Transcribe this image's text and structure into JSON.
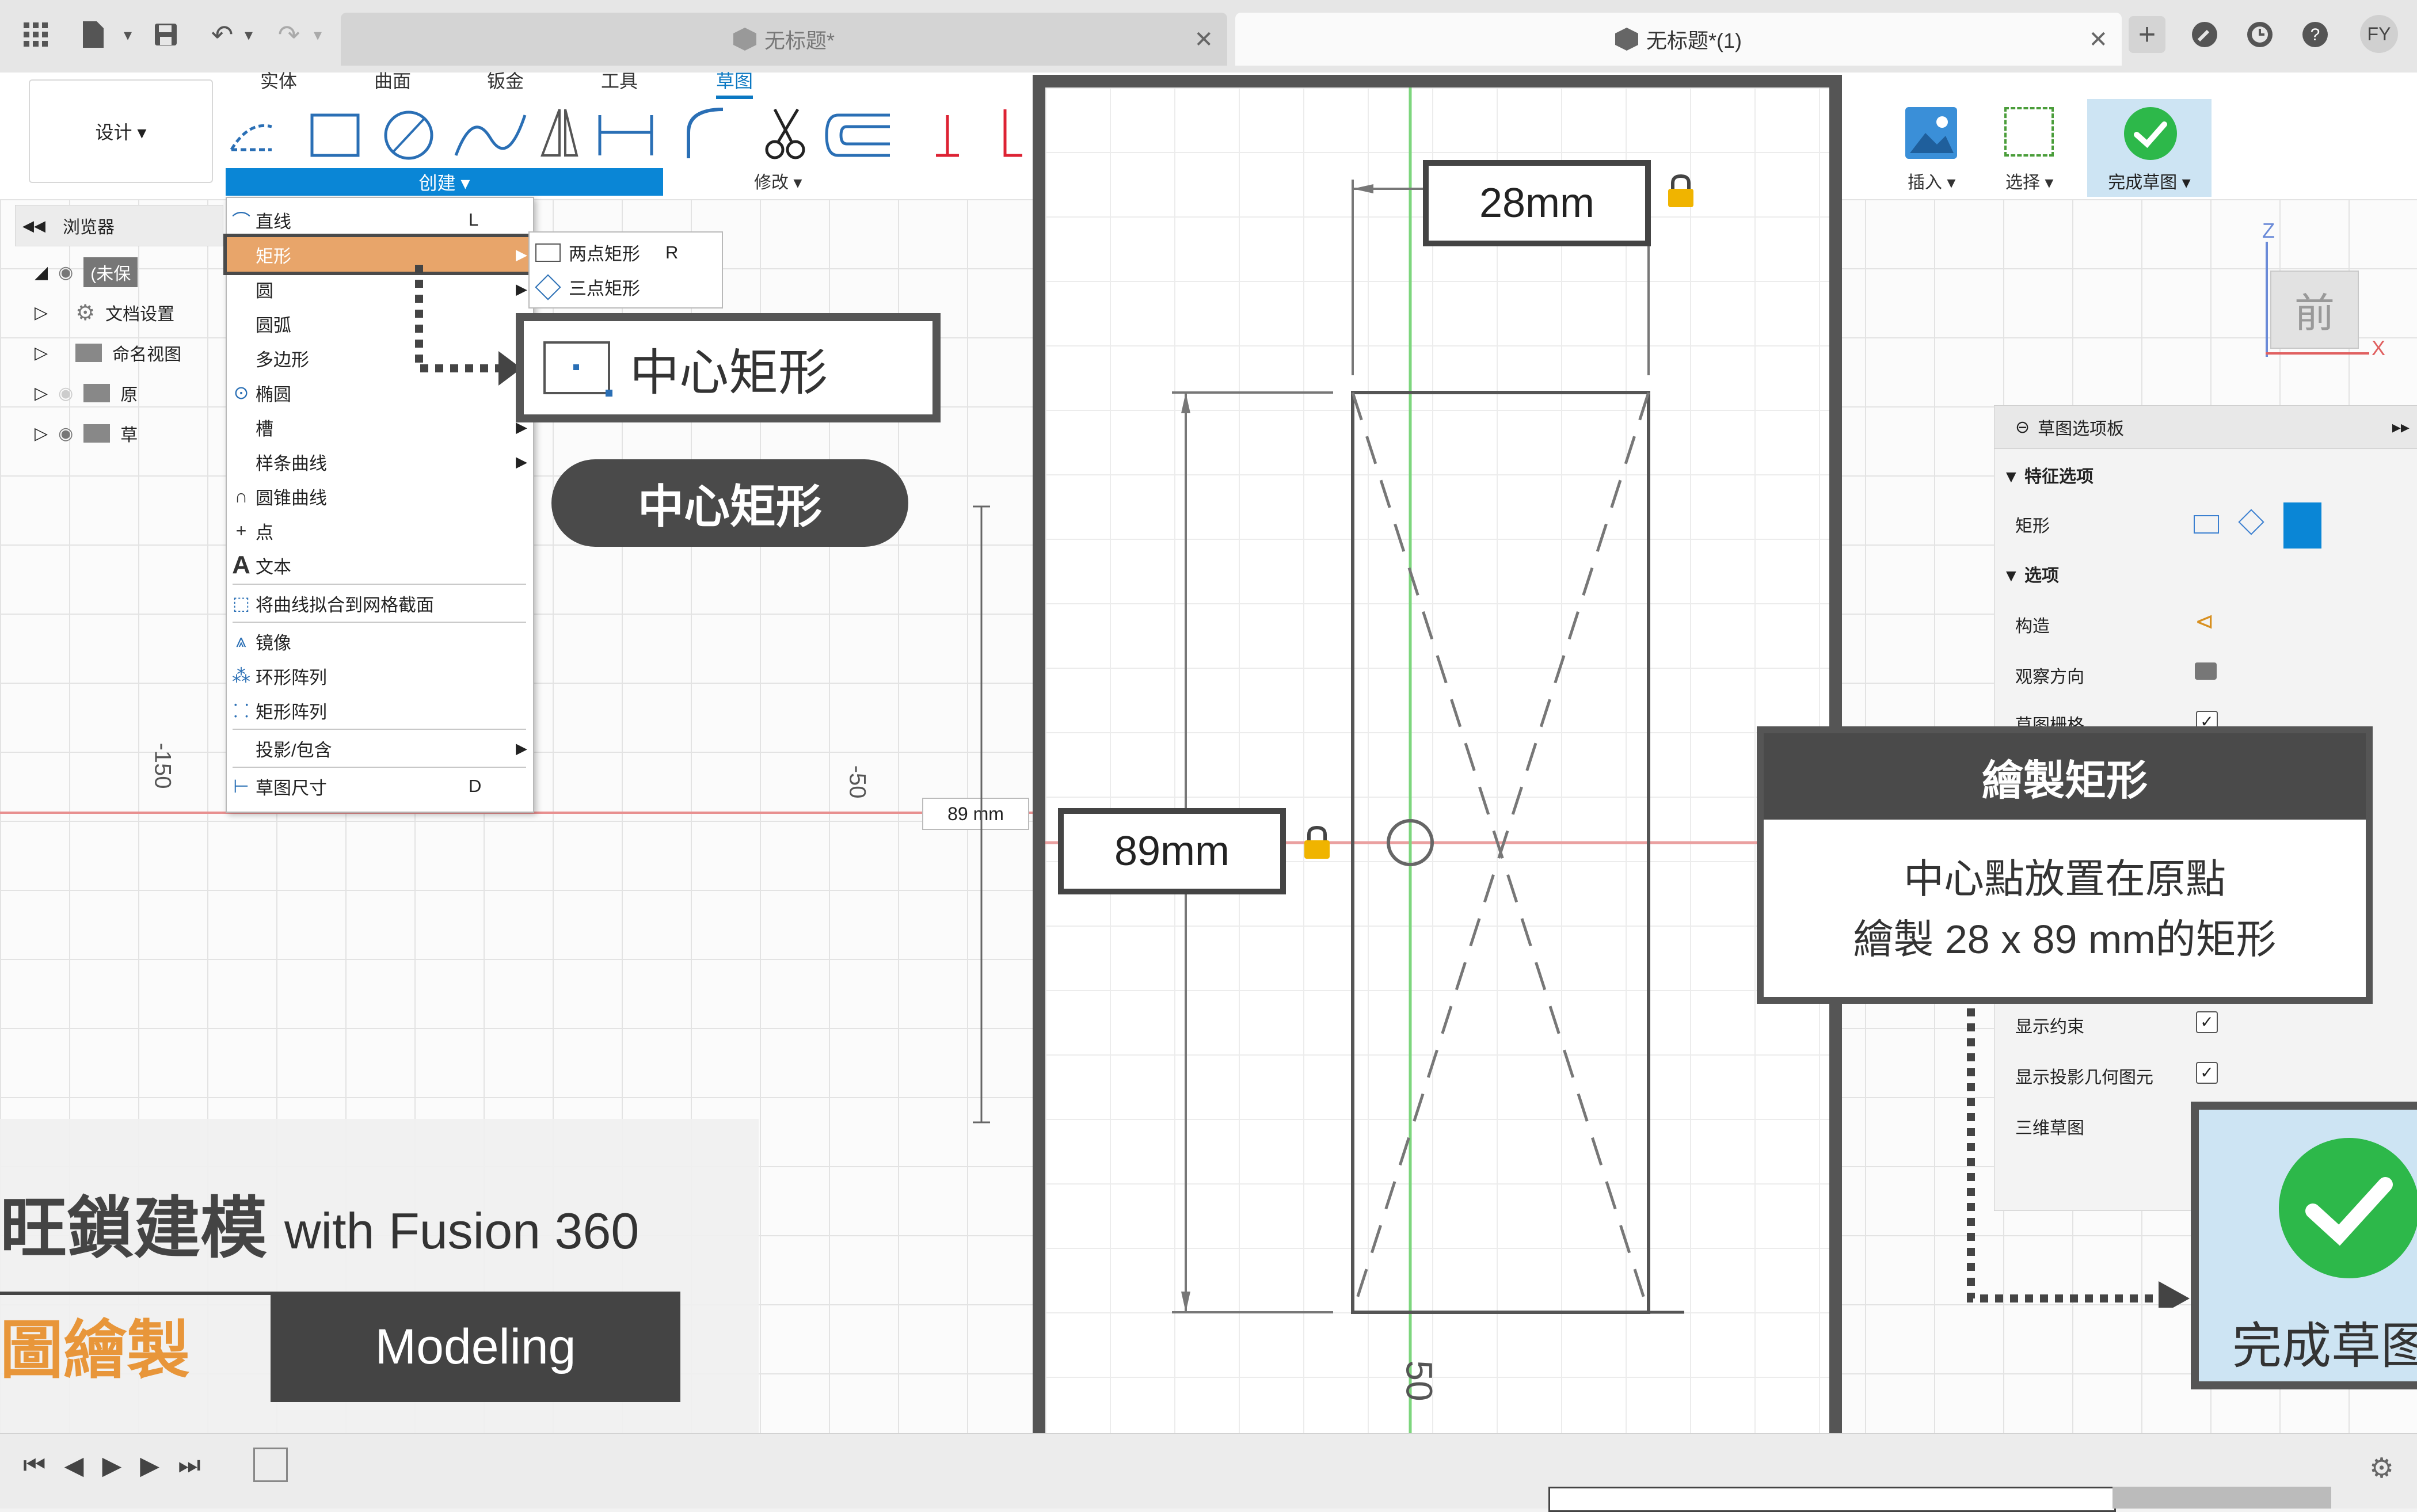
{
  "tabs": [
    {
      "label": "无标题*",
      "active": false
    },
    {
      "label": "无标题*(1)",
      "active": true
    }
  ],
  "user_initials": "FY",
  "workspace_button": "设计 ▾",
  "ribbon_tabs": [
    "实体",
    "曲面",
    "钣金",
    "工具",
    "草图"
  ],
  "ribbon_active": "草图",
  "create_label": "创建 ▾",
  "modify_label": "修改 ▾",
  "insert_label": "插入 ▾",
  "select_label": "选择 ▾",
  "finish_label": "完成草图 ▾",
  "browser": {
    "title": "浏览器",
    "items": [
      "(未保",
      "文档设置",
      "命名视图",
      "原",
      "草"
    ]
  },
  "menu": {
    "items": [
      {
        "label": "直线",
        "shortcut": "L"
      },
      {
        "label": "矩形",
        "has_sub": true
      },
      {
        "label": "圆",
        "has_sub": true
      },
      {
        "label": "圆弧",
        "has_sub": true
      },
      {
        "label": "多边形",
        "has_sub": true
      },
      {
        "label": "椭圆"
      },
      {
        "label": "槽",
        "has_sub": true
      },
      {
        "label": "样条曲线",
        "has_sub": true
      },
      {
        "label": "圆锥曲线"
      },
      {
        "label": "点"
      },
      {
        "label": "文本"
      },
      {
        "label": "将曲线拟合到网格截面"
      },
      {
        "label": "镜像"
      },
      {
        "label": "环形阵列"
      },
      {
        "label": "矩形阵列"
      },
      {
        "label": "投影/包含",
        "has_sub": true
      },
      {
        "label": "草图尺寸",
        "shortcut": "D"
      }
    ]
  },
  "submenu": [
    {
      "label": "两点矩形",
      "shortcut": "R"
    },
    {
      "label": "三点矩形"
    }
  ],
  "callout_center_rect": "中心矩形",
  "pill_label": "中心矩形",
  "canvas_labels": {
    "neg150": "-150",
    "neg50": "-50",
    "dim89": "89 mm",
    "fifty": "50"
  },
  "zoom_panel": {
    "width_dim": "28mm",
    "height_dim": "89mm",
    "axis_label": "50"
  },
  "viewcube": {
    "face": "前",
    "z": "Z",
    "x": "X"
  },
  "sketch_palette": {
    "title": "草图选项板",
    "section_feature": "特征选项",
    "rect_label": "矩形",
    "section_options": "选项",
    "construct": "构造",
    "look_at": "观察方向",
    "sketch_grid": "草图栅格",
    "show_constraints": "显示约束",
    "show_projected": "显示投影几何图元",
    "three_d_sketch": "三维草图"
  },
  "info_box": {
    "title": "繪製矩形",
    "line1": "中心點放置在原點",
    "line2": "繪製 28 x 89 mm的矩形"
  },
  "finish_zoom_label": "完成草图",
  "overlay": {
    "title": "旺鎖建模",
    "subtitle": "with Fusion 360",
    "orange": "圖繪製",
    "modeling": "Modeling"
  },
  "colors": {
    "accent_blue": "#0a86d6",
    "highlight_orange": "#e8a56a",
    "dark_panel": "#4a4a4a",
    "green_check": "#2db84a",
    "axis_green": "#66cc66",
    "axis_red": "#e89090"
  }
}
